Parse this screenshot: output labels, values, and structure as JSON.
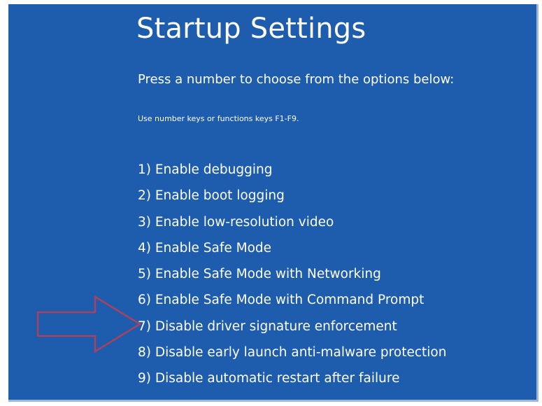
{
  "title": "Startup Settings",
  "subtitle": "Press a number to choose from the options below:",
  "hint": "Use number keys or functions keys F1-F9.",
  "options": [
    "1) Enable debugging",
    "2) Enable boot logging",
    "3) Enable low-resolution video",
    "4) Enable Safe Mode",
    "5) Enable Safe Mode with Networking",
    "6) Enable Safe Mode with Command Prompt",
    "7) Disable driver signature enforcement",
    "8) Disable early launch anti-malware protection",
    "9) Disable automatic restart after failure"
  ],
  "colors": {
    "background": "#1e5cad",
    "text": "#ffffff",
    "arrow": "#a8435f"
  },
  "icons": {
    "arrow": "right-arrow-icon"
  }
}
